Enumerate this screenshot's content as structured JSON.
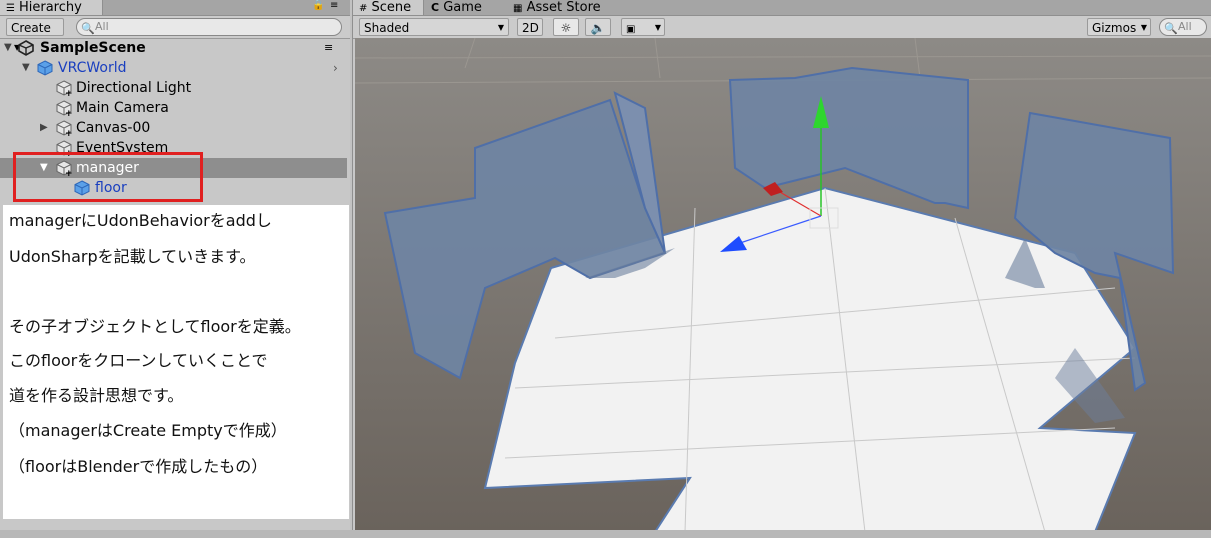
{
  "hierarchy": {
    "tab_label": "Hierarchy",
    "create_label": "Create",
    "search_placeholder": "All",
    "scene_name": "SampleScene",
    "items": [
      {
        "label": "VRCWorld"
      },
      {
        "label": "Directional Light"
      },
      {
        "label": "Main Camera"
      },
      {
        "label": "Canvas-00"
      },
      {
        "label": "EventSystem"
      },
      {
        "label": "manager"
      },
      {
        "label": "floor"
      }
    ]
  },
  "note": {
    "lines": [
      "managerにUdonBehaviorをaddし",
      "UdonSharpを記載していきます。",
      "",
      "その子オブジェクトとしてfloorを定義。",
      "このfloorをクローンしていくことで",
      "道を作る設計思想です。",
      "（managerはCreate Emptyで作成）",
      "（floorはBlenderで作成したもの）"
    ]
  },
  "scene": {
    "tabs": [
      {
        "label": "Scene"
      },
      {
        "label": "Game"
      },
      {
        "label": "Asset Store"
      }
    ],
    "shading_mode": "Shaded",
    "btn_2d": "2D",
    "gizmos_label": "Gizmos",
    "search_placeholder": "All"
  },
  "colors": {
    "selection_highlight": "#e02020",
    "prefab_blue": "#1a3fbf",
    "wall": "#6f84a3",
    "floor": "#f2f2f2",
    "background": "#6e6760"
  }
}
